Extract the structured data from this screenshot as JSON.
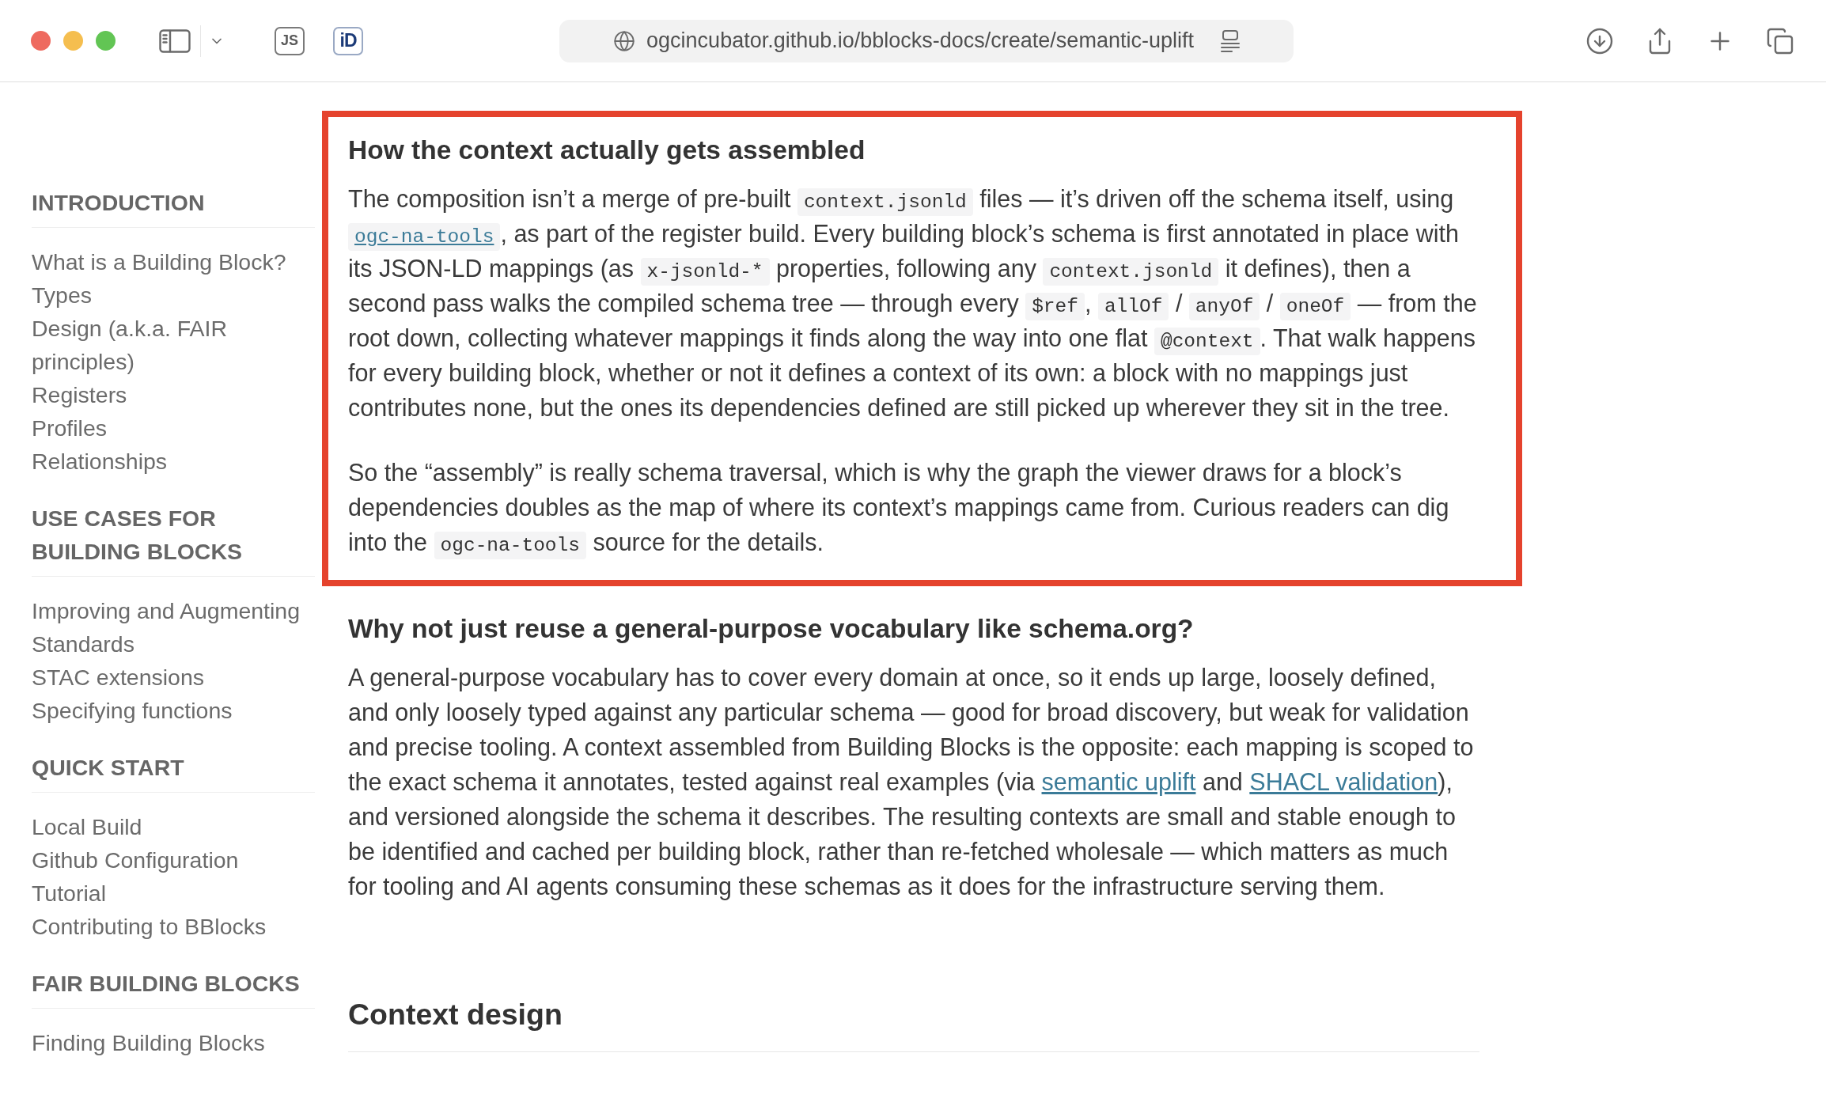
{
  "window_controls": [
    {
      "color": "#ee6a5f"
    },
    {
      "color": "#f5be4f"
    },
    {
      "color": "#62c554"
    }
  ],
  "toolbar": {
    "extensions": [
      {
        "kind": "js",
        "label": "JS"
      },
      {
        "kind": "id",
        "label": "iD"
      }
    ],
    "address_bar": {
      "url": "ogcincubator.github.io/bblocks-docs/create/semantic-uplift"
    }
  },
  "sidebar": {
    "sections": [
      {
        "title": "INTRODUCTION",
        "items": [
          {
            "label": "What is a Building Block?"
          },
          {
            "label": "Types"
          },
          {
            "label": "Design (a.k.a. FAIR principles)"
          },
          {
            "label": "Registers"
          },
          {
            "label": "Profiles"
          },
          {
            "label": "Relationships"
          }
        ]
      },
      {
        "title": "USE CASES FOR BUILDING BLOCKS",
        "items": [
          {
            "label": "Improving and Augmenting Standards"
          },
          {
            "label": "STAC extensions"
          },
          {
            "label": "Specifying functions"
          }
        ]
      },
      {
        "title": "QUICK START",
        "items": [
          {
            "label": "Local Build"
          },
          {
            "label": "Github Configuration"
          },
          {
            "label": "Tutorial"
          },
          {
            "label": "Contributing to BBlocks"
          }
        ]
      },
      {
        "title": "FAIR BUILDING BLOCKS",
        "items": [
          {
            "label": "Finding Building Blocks"
          }
        ]
      }
    ]
  },
  "article": {
    "sections": [
      {
        "kind": "subsection",
        "highlighted": true,
        "heading": "How the context actually gets assembled",
        "paragraphs": [
          {
            "segments": [
              {
                "kind": "text",
                "text": "The composition isn’t a merge of pre-built "
              },
              {
                "kind": "code",
                "text": "context.jsonld"
              },
              {
                "kind": "text",
                "text": " files — it’s driven off the schema itself, using "
              },
              {
                "kind": "code_link",
                "text": "ogc-na-tools"
              },
              {
                "kind": "text",
                "text": ", as part of the register build. Every building block’s schema is first annotated in place with its JSON-LD mappings (as "
              },
              {
                "kind": "code",
                "text": "x-jsonld-*"
              },
              {
                "kind": "text",
                "text": " properties, following any "
              },
              {
                "kind": "code",
                "text": "context.jsonld"
              },
              {
                "kind": "text",
                "text": " it defines), then a second pass walks the compiled schema tree — through every "
              },
              {
                "kind": "code",
                "text": "$ref"
              },
              {
                "kind": "text",
                "text": ", "
              },
              {
                "kind": "code",
                "text": "allOf"
              },
              {
                "kind": "text",
                "text": " / "
              },
              {
                "kind": "code",
                "text": "anyOf"
              },
              {
                "kind": "text",
                "text": " / "
              },
              {
                "kind": "code",
                "text": "oneOf"
              },
              {
                "kind": "text",
                "text": " — from the root down, collecting whatever mappings it finds along the way into one flat "
              },
              {
                "kind": "code",
                "text": "@context"
              },
              {
                "kind": "text",
                "text": ". That walk happens for every building block, whether or not it defines a context of its own: a block with no mappings just contributes none, but the ones its dependencies defined are still picked up wherever they sit in the tree."
              }
            ]
          },
          {
            "segments": [
              {
                "kind": "text",
                "text": "So the “assembly” is really schema traversal, which is why the graph the viewer draws for a block’s dependencies doubles as the map of where its context’s mappings came from. Curious readers can dig into the "
              },
              {
                "kind": "code",
                "text": "ogc-na-tools"
              },
              {
                "kind": "text",
                "text": " source for the details."
              }
            ]
          }
        ]
      },
      {
        "kind": "subsection",
        "highlighted": false,
        "heading": "Why not just reuse a general-purpose vocabulary like schema.org?",
        "paragraphs": [
          {
            "segments": [
              {
                "kind": "text",
                "text": "A general-purpose vocabulary has to cover every domain at once, so it ends up large, loosely defined, and only loosely typed against any particular schema — good for broad discovery, but weak for validation and precise tooling. A context assembled from Building Blocks is the opposite: each mapping is scoped to the exact schema it annotates, tested against real examples (via "
              },
              {
                "kind": "link",
                "text": "semantic uplift"
              },
              {
                "kind": "text",
                "text": " and "
              },
              {
                "kind": "link",
                "text": "SHACL validation"
              },
              {
                "kind": "text",
                "text": "), and versioned alongside the schema it describes. The resulting contexts are small and stable enough to be identified and cached per building block, rather than re-fetched wholesale — which matters as much for tooling and AI agents consuming these schemas as it does for the infrastructure serving them."
              }
            ]
          }
        ]
      },
      {
        "kind": "section",
        "highlighted": false,
        "heading": "Context design"
      }
    ]
  }
}
